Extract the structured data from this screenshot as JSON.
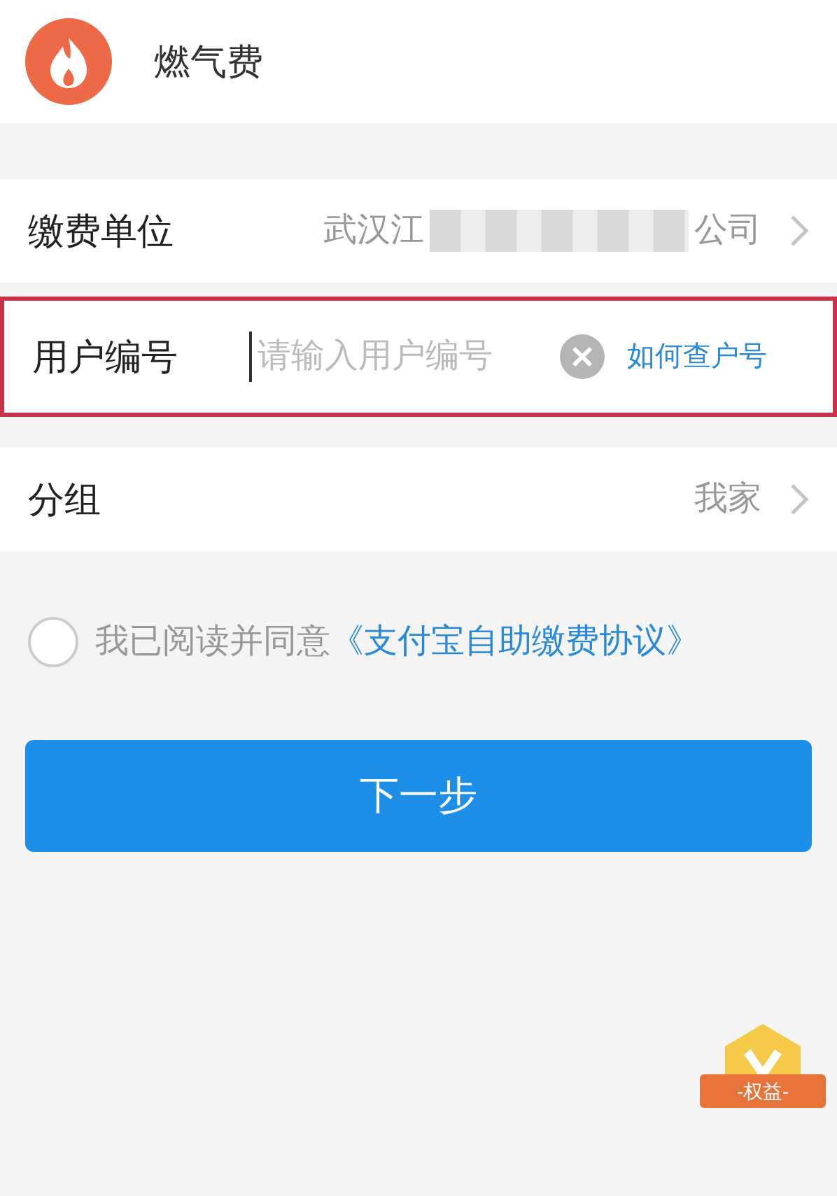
{
  "header": {
    "title": "燃气费"
  },
  "rows": [
    {
      "kind": "select",
      "label": "缴费单位",
      "value_start": "武汉江",
      "value_end": "公司",
      "redacted": true,
      "highlighted": false
    },
    {
      "kind": "input",
      "label": "用户编号",
      "placeholder": "请输入用户编号",
      "link": "如何查户号",
      "highlighted": true
    },
    {
      "kind": "select",
      "label": "分组",
      "value_end": "我家",
      "redacted": false,
      "highlighted": false
    }
  ],
  "agreement": {
    "checked": false,
    "text": "我已阅读并同意",
    "link": "《支付宝自助缴费协议》"
  },
  "next_button": "下一步",
  "badge": {
    "label": "-权益-"
  }
}
